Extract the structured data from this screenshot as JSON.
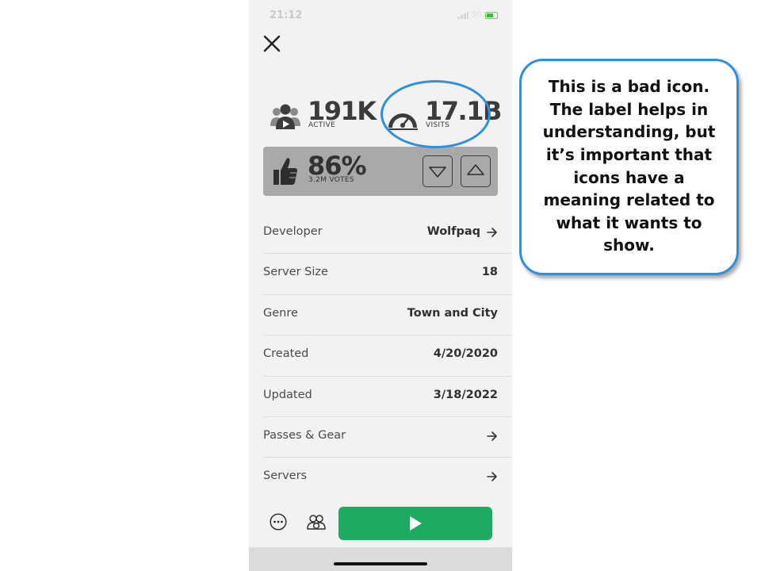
{
  "status_bar": {
    "time": "21:12",
    "network": "5G"
  },
  "stats": {
    "active": {
      "value": "191K",
      "label": "ACTIVE"
    },
    "visits": {
      "value": "17.1B",
      "label": "VISITS"
    }
  },
  "votes": {
    "percent": "86%",
    "label": "3.2M VOTES"
  },
  "details": [
    {
      "label": "Developer",
      "value": "Wolfpaq",
      "arrow": true
    },
    {
      "label": "Server Size",
      "value": "18",
      "arrow": false
    },
    {
      "label": "Genre",
      "value": "Town and City",
      "arrow": false
    },
    {
      "label": "Created",
      "value": "4/20/2020",
      "arrow": false
    },
    {
      "label": "Updated",
      "value": "3/18/2022",
      "arrow": false
    },
    {
      "label": "Passes & Gear",
      "value": "",
      "arrow": true
    },
    {
      "label": "Servers",
      "value": "",
      "arrow": true
    }
  ],
  "callout": {
    "text": "This is a bad icon. The label helps in understanding, but it’s important that icons have a meaning related to what it wants to show."
  },
  "colors": {
    "play": "#1faa63",
    "highlight": "#2f8fdc",
    "vote_panel": "#a9a9a9",
    "background": "#f2f2f2"
  },
  "icons": [
    "close-icon",
    "users-play-icon",
    "speedometer-icon",
    "thumbs-up-icon",
    "thumbs-down-icon",
    "thumbs-up-vote-icon",
    "arrow-right-icon",
    "more-icon",
    "friends-icon",
    "play-icon"
  ]
}
